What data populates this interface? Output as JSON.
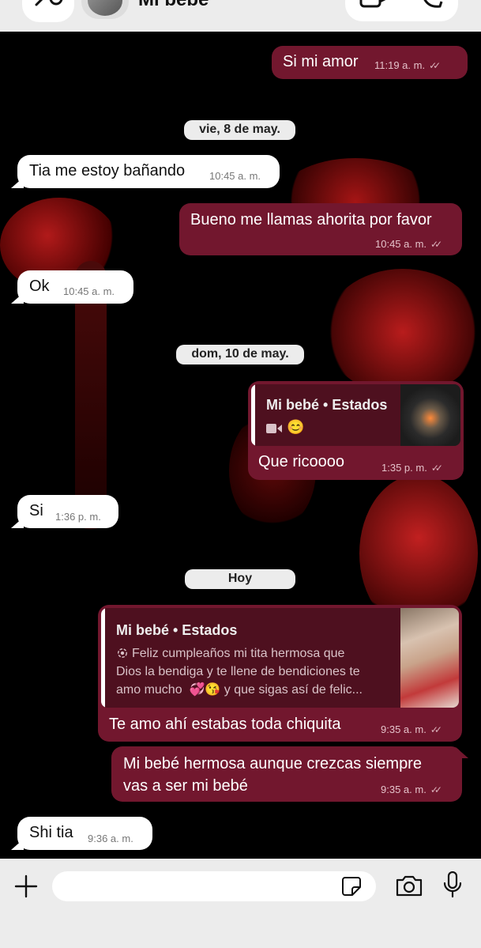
{
  "header": {
    "title": "Mi bebé"
  },
  "messages": {
    "m1": {
      "text": "Si mi amor",
      "time": "11:19 a. m."
    },
    "d1": "vie, 8 de may.",
    "m2": {
      "text": "Tia me estoy bañando",
      "time": "10:45 a. m."
    },
    "m3": {
      "text": "Bueno me llamas ahorita por favor",
      "time": "10:45 a. m."
    },
    "m4": {
      "text": "Ok",
      "time": "10:45 a. m."
    },
    "d2": "dom, 10 de may.",
    "m5": {
      "quote_title": "Mi bebé • Estados",
      "quote_emoji": "😊",
      "text": "Que ricoooo",
      "time": "1:35 p. m."
    },
    "m6": {
      "text": "Si",
      "time": "1:36 p. m."
    },
    "d3": "Hoy",
    "m7": {
      "quote_title": "Mi bebé • Estados",
      "quote_line1": "Feliz cumpleaños mi tita hermosa que",
      "quote_line2": "Dios la bendiga y te llene de bendiciones te",
      "quote_line3a": "amo mucho",
      "quote_emojis": "💞😘",
      "quote_line3b": "y que sigas así de felic...",
      "text": "Te amo ahí estabas toda chiquita",
      "time": "9:35 a. m."
    },
    "m8": {
      "line1": "Mi bebé hermosa aunque crezcas siempre",
      "line2": "vas a ser mi bebé",
      "time": "9:35 a. m."
    },
    "m9": {
      "text": "Shi tia",
      "time": "9:36 a. m."
    }
  },
  "colors": {
    "outgoing_bubble": "#72172e",
    "incoming_bubble": "#ffffff",
    "date_chip": "#ececec",
    "bars": "#ececec"
  },
  "icons": [
    "back-arrow-icon",
    "video-call-icon",
    "phone-icon",
    "plus-icon",
    "sticker-icon",
    "camera-icon",
    "microphone-icon",
    "read-receipt-icon",
    "video-icon"
  ]
}
